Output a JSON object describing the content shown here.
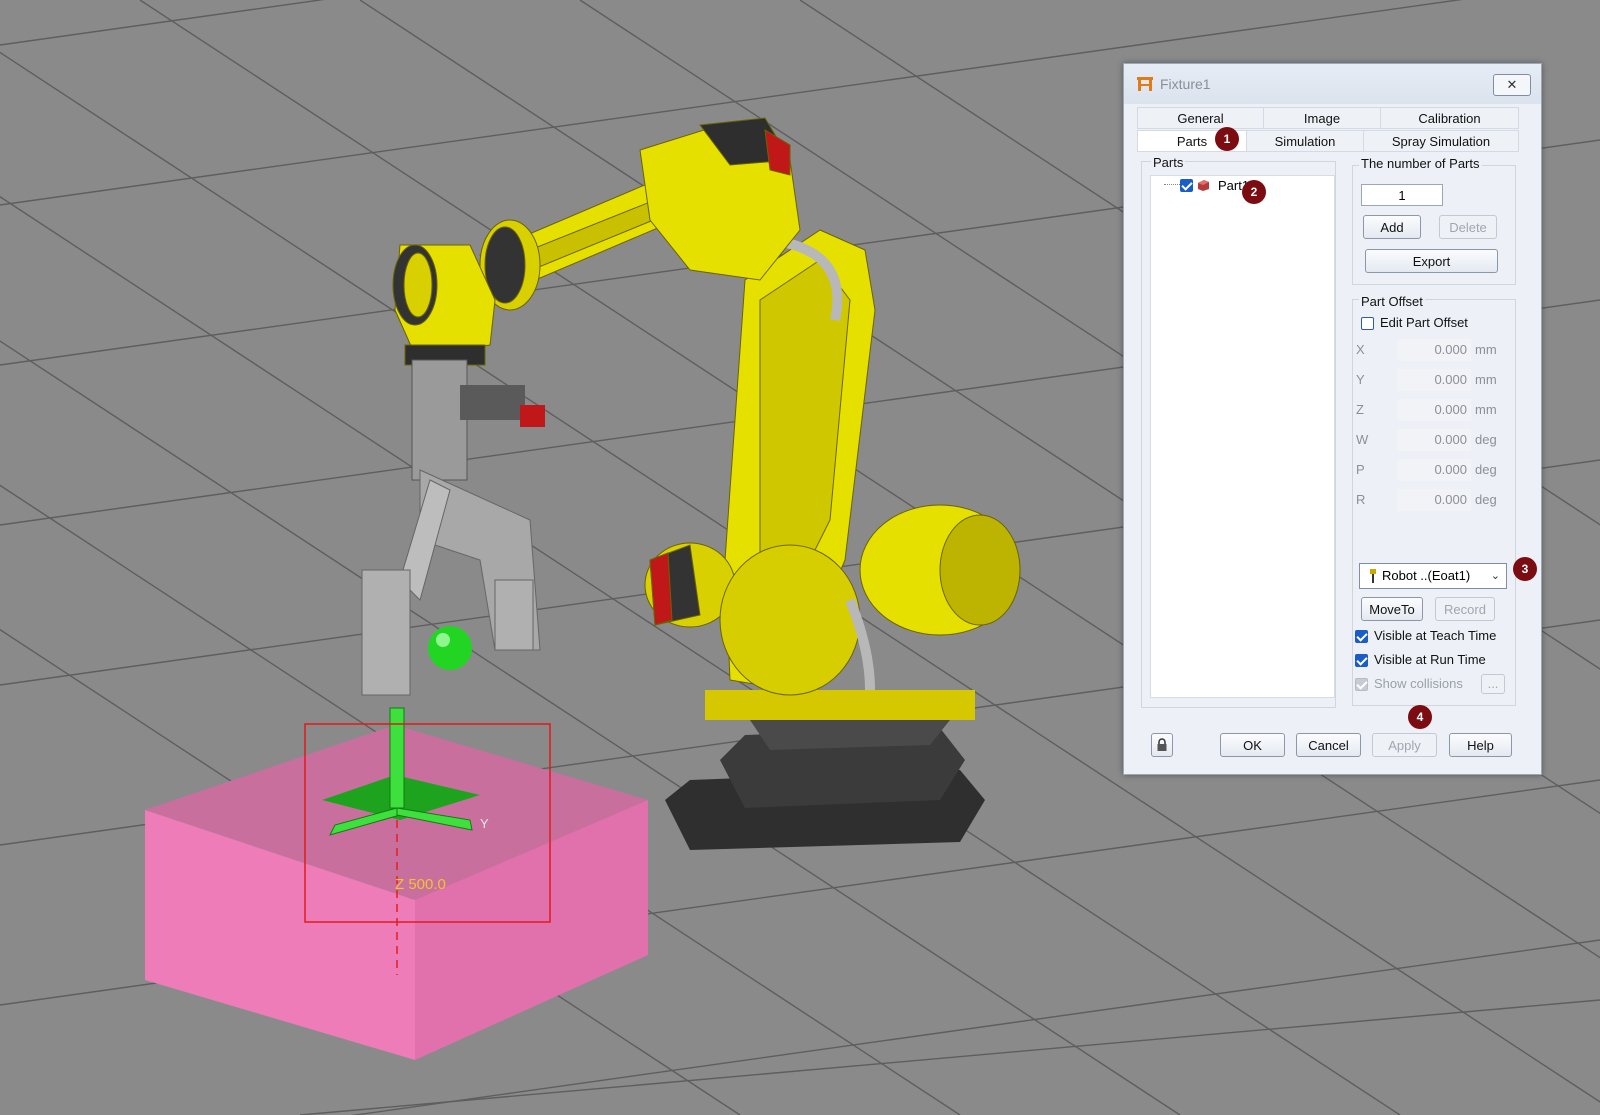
{
  "viewport": {
    "z_readout": "Z 500.0",
    "y_axis_label": "Y",
    "colors": {
      "background": "#8a8a8a",
      "robot": "#e6e000",
      "fixture_box": "#ec7bb8",
      "target_sphere": "#22d522",
      "selection_box": "#e01b1b"
    }
  },
  "dialog": {
    "title": "Fixture1",
    "title_icon": "fixture-icon",
    "close_icon": "close-icon",
    "tabs_row1": [
      "General",
      "Image",
      "Calibration"
    ],
    "tabs_row2": [
      "Parts",
      "Simulation",
      "Spray Simulation"
    ],
    "active_tab": "Parts",
    "markers": [
      "1",
      "2",
      "3",
      "4"
    ],
    "parts_group_label": "Parts",
    "tree": {
      "items": [
        {
          "label": "Part1",
          "checked": true,
          "icon": "part-icon"
        }
      ]
    },
    "number_of_parts": {
      "label": "The number of Parts",
      "value": "1",
      "add": "Add",
      "delete": "Delete",
      "export": "Export"
    },
    "part_offset": {
      "label": "Part Offset",
      "edit_checkbox": "Edit Part Offset",
      "edit_checked": false,
      "rows": [
        {
          "axis": "X",
          "value": "0.000",
          "unit": "mm"
        },
        {
          "axis": "Y",
          "value": "0.000",
          "unit": "mm"
        },
        {
          "axis": "Z",
          "value": "0.000",
          "unit": "mm"
        },
        {
          "axis": "W",
          "value": "0.000",
          "unit": "deg"
        },
        {
          "axis": "P",
          "value": "0.000",
          "unit": "deg"
        },
        {
          "axis": "R",
          "value": "0.000",
          "unit": "deg"
        }
      ]
    },
    "robot_select": {
      "value": "Robot ..(Eoat1)",
      "icon": "robot-tool-icon"
    },
    "moveto": "MoveTo",
    "record": "Record",
    "visible_teach": {
      "label": "Visible at Teach Time",
      "checked": true
    },
    "visible_run": {
      "label": "Visible at Run Time",
      "checked": true
    },
    "show_collisions": {
      "label": "Show collisions",
      "checked": true,
      "disabled": true,
      "more": "..."
    },
    "footer": {
      "lock_icon": "lock-icon",
      "ok": "OK",
      "cancel": "Cancel",
      "apply": "Apply",
      "help": "Help"
    }
  }
}
